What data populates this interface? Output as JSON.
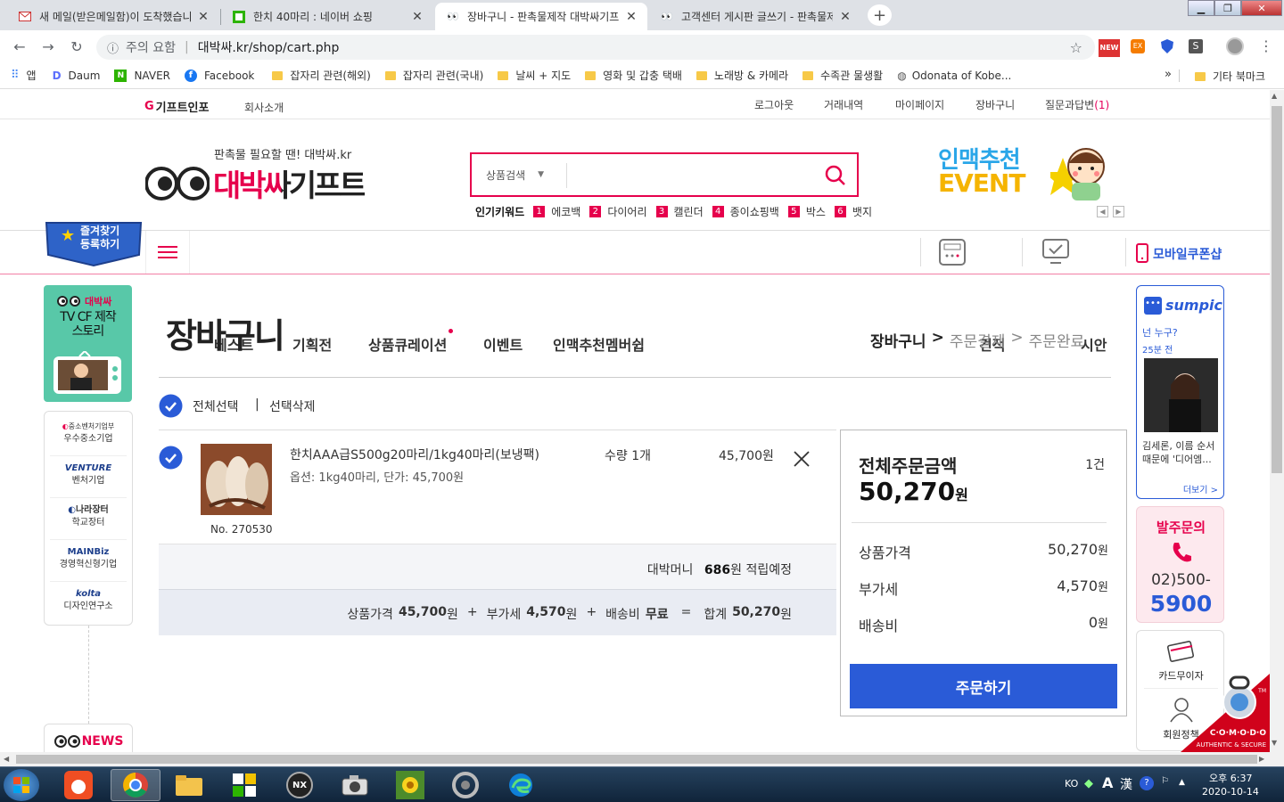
{
  "browser": {
    "tabs": [
      {
        "title": "새 메일(받은메일함)이 도착했습니다",
        "active": false
      },
      {
        "title": "한치 40마리 : 네이버 쇼핑",
        "active": false
      },
      {
        "title": "장바구니 - 판촉물제작 대박싸기프트",
        "active": true
      },
      {
        "title": "고객센터 게시판 글쓰기 - 판촉물제작",
        "active": false
      }
    ],
    "security_label": "주의 요함",
    "url": "대박싸.kr/shop/cart.php",
    "bookmarks": [
      "앱",
      "Daum",
      "NAVER",
      "Facebook",
      "잡자리 관련(해외)",
      "잡자리 관련(국내)",
      "날씨 + 지도",
      "영화 및 갑충 택배",
      "노래방 & 카메라",
      "수족관 물생활",
      "Odonata of Kobe...",
      "기타 북마크"
    ],
    "more": "»",
    "ext_new": "NEW",
    "ext_ex": "EX",
    "ext_s": "S"
  },
  "site": {
    "top_logo": "기프트인포",
    "top_about": "회사소개",
    "top_menu": [
      "로그아웃",
      "거래내역",
      "마이페이지",
      "장바구니",
      "질문과답변"
    ],
    "qna_count": "(1)",
    "tagline": "판촉물 필요할 땐! 대박싸.kr",
    "logo_text": "대박싸기프트",
    "search_category": "상품검색",
    "hot_keywords_label": "인기키워드",
    "hot_keywords": [
      "에코백",
      "다이어리",
      "캘린더",
      "종이쇼핑백",
      "박스",
      "뱃지"
    ],
    "hot_nums": [
      "1",
      "2",
      "3",
      "4",
      "5",
      "6"
    ],
    "event_line1": "인맥추천",
    "event_line2": "EVENT",
    "favorite_line1": "즐겨찾기",
    "favorite_line2": "등록하기",
    "nav": [
      "베스트",
      "기획전",
      "상품큐레이션",
      "이벤트",
      "인맥추천멤버쉽"
    ],
    "nav_right": [
      "견적",
      "시안"
    ],
    "mobile_coupon": "모바일쿠폰샵"
  },
  "left_sidebar": {
    "tvcf_logo": "대박싸",
    "tvcf_line1": "TV CF 제작",
    "tvcf_line2": "스토리",
    "certs": [
      {
        "top": "중소벤처기업부",
        "bottom": "우수중소기업"
      },
      {
        "top": "VENTURE",
        "bottom": "벤처기업"
      },
      {
        "top": "나라장터",
        "bottom": "학교장터"
      },
      {
        "top": "MAINBiz",
        "bottom": "경영혁신형기업"
      },
      {
        "top": "kolta",
        "bottom": "디자인연구소"
      }
    ],
    "news": "NEWS"
  },
  "cart": {
    "title": "장바구니",
    "steps": [
      "장바구니",
      "주문결제",
      "주문완료"
    ],
    "step_sep": ">",
    "select_all": "전체선택",
    "sep": "|",
    "delete_selected": "선택삭제",
    "item": {
      "name": "한치AAA급S500g20마리/1kg40마리(보냉팩)",
      "option": "옵션: 1kg40마리, 단가: 45,700원",
      "qty": "수량 1개",
      "price": "45,700원",
      "no": "No. 270530"
    },
    "points_label": "대박머니",
    "points_value": "686",
    "points_unit": "원 적립예정",
    "summary": {
      "goods_label": "상품가격",
      "goods_value": "45,700",
      "won1": "원",
      "plus1": "+",
      "vat_label": "부가세",
      "vat_value": "4,570",
      "won2": "원",
      "plus2": "+",
      "ship_label": "배송비",
      "ship_value": "무료",
      "eq": "=",
      "total_label": "합계",
      "total_value": "50,270",
      "won3": "원"
    }
  },
  "order_box": {
    "title": "전체주문금액",
    "count": "1건",
    "total": "50,270",
    "total_unit": "원",
    "rows": [
      {
        "label": "상품가격",
        "value": "50,270",
        "unit": "원"
      },
      {
        "label": "부가세",
        "value": "4,570",
        "unit": "원"
      },
      {
        "label": "배송비",
        "value": "0",
        "unit": "원"
      }
    ],
    "button": "주문하기"
  },
  "right_sidebar": {
    "sumpic": "sumpic",
    "q": "넌 누구?",
    "time": "25분 전",
    "caption": "김세론, 이름 순서 때문에 '디어엠...",
    "more": "더보기 >",
    "call_title": "발주문의",
    "call_num1": "02)500-",
    "call_num2": "5900",
    "card": "카드무이자",
    "member": "회원정책",
    "comodo": "C·O·M·O·D·O",
    "comodo_sub": "AUTHENTIC & SECURE",
    "tm": "TM"
  },
  "taskbar": {
    "ime": "KO",
    "ime2": "A",
    "hanja": "漢",
    "ampm": "오후 6:37",
    "date": "2020-10-14",
    "nx": "NX"
  },
  "colors": {
    "brand": "#e6004c",
    "blue": "#2a5bd7",
    "gray_bg": "#f4f5f8"
  }
}
